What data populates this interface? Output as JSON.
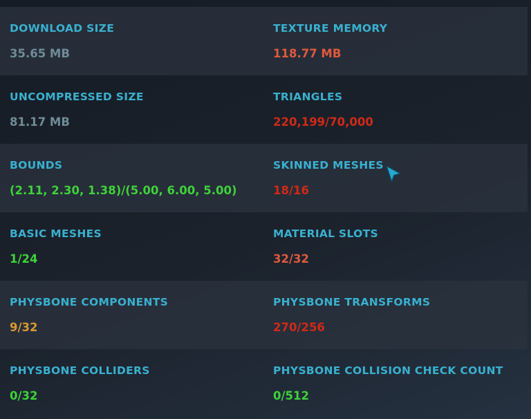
{
  "colors": {
    "label": "#3ab0cf",
    "neutral": "#6f8c97",
    "good": "#3fd13a",
    "warn": "#d79a35",
    "bad_light": "#e0593e",
    "bad": "#cf2a17"
  },
  "stats": [
    {
      "label": "DOWNLOAD SIZE",
      "value": "35.65 MB",
      "color": "#6f8c97"
    },
    {
      "label": "TEXTURE MEMORY",
      "value": "118.77 MB",
      "color": "#e0593e"
    },
    {
      "label": "UNCOMPRESSED SIZE",
      "value": "81.17 MB",
      "color": "#6f8c97"
    },
    {
      "label": "TRIANGLES",
      "value": "220,199/70,000",
      "color": "#cf2a17"
    },
    {
      "label": "BOUNDS",
      "value": "(2.11, 2.30, 1.38)/(5.00, 6.00, 5.00)",
      "color": "#3fd13a"
    },
    {
      "label": "SKINNED MESHES",
      "value": "18/16",
      "color": "#cf2a17"
    },
    {
      "label": "BASIC MESHES",
      "value": "1/24",
      "color": "#3fd13a"
    },
    {
      "label": "MATERIAL SLOTS",
      "value": "32/32",
      "color": "#e0593e"
    },
    {
      "label": "PHYSBONE COMPONENTS",
      "value": "9/32",
      "color": "#d79a35"
    },
    {
      "label": "PHYSBONE TRANSFORMS",
      "value": "270/256",
      "color": "#cf2a17"
    },
    {
      "label": "PHYSBONE COLLIDERS",
      "value": "0/32",
      "color": "#3fd13a"
    },
    {
      "label": "PHYSBONE COLLISION CHECK COUNT",
      "value": "0/512",
      "color": "#3fd13a"
    }
  ],
  "cursor_icon": "mouse-pointer-icon"
}
